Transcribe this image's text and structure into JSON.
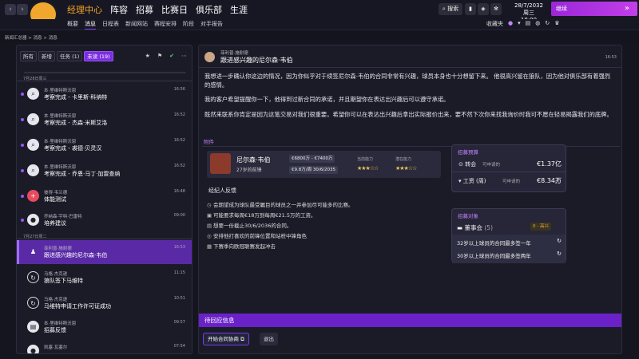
{
  "nav": {
    "main": [
      "经理中心",
      "阵容",
      "招募",
      "比赛日",
      "俱乐部",
      "生涯"
    ],
    "sub": [
      "概要",
      "消息",
      "日程表",
      "新闻网站",
      "赛程安排",
      "阶段",
      "对手报告"
    ],
    "search": "搜索",
    "date_line1": "28/7/2032",
    "date_line2": "周三 18:00",
    "continue": "继续",
    "folder": "收藏夹"
  },
  "breadcrumb": "新闻汇总器 > 消息 > 消息",
  "filters": [
    "所有",
    "新增",
    "任务 (1)",
    "未读 (19)"
  ],
  "days": [
    "7月28日周三",
    "7月27日周二"
  ],
  "messages": [
    {
      "from": "本·里维特斯沃恩",
      "subject": "考察完成 - 卡里斯·科纳特",
      "time": "16:56",
      "icon": "magnifier-icon"
    },
    {
      "from": "本·里维特斯沃恩",
      "subject": "考察完成 - 杰森·米斯艾洛",
      "time": "16:52",
      "icon": "magnifier-icon"
    },
    {
      "from": "本·里维特斯沃恩",
      "subject": "考察完成 - 裘德·贝灵汉",
      "time": "16:52",
      "icon": "magnifier-icon"
    },
    {
      "from": "本·里维特斯沃恩",
      "subject": "考察完成 - 乔恩·马丁·加雷查纳",
      "time": "16:52",
      "icon": "magnifier-icon"
    },
    {
      "from": "彼得·韦兰德",
      "subject": "体能测试",
      "time": "16:48",
      "icon": "medical-icon"
    },
    {
      "from": "乔纳森·宇特·巴雷特",
      "subject": "培养建议",
      "time": "09:00",
      "icon": "person-icon"
    },
    {
      "from": "菲利普·施耐德",
      "subject": "跟进感兴趣的尼尔森·韦伯",
      "time": "16:53",
      "icon": "person-icon"
    },
    {
      "from": "马格·杰克逊",
      "subject": "狼队签下马维特",
      "time": "11:15",
      "icon": "refresh-icon"
    },
    {
      "from": "马格·杰克逊",
      "subject": "马维特申请工作许可证成功",
      "time": "10:51",
      "icon": "refresh-icon"
    },
    {
      "from": "本·里维特斯沃恩",
      "subject": "招募反馈",
      "time": "09:57",
      "icon": "inbox-icon"
    },
    {
      "from": "凯塞·瓦塞尔",
      "subject": "",
      "time": "07:54",
      "icon": "person-icon"
    }
  ],
  "detail": {
    "from": "菲利普·施耐德",
    "subject": "跟进感兴趣的尼尔森·韦伯",
    "time": "16:53",
    "p1": "我想进一步确认你这边的情况，因为你似乎对于续签尼尔森·韦伯的合同非常有兴趣，球员本身也十分想留下来。 他很高兴留在狼队，因为他对俱乐部有着强烈的感情。",
    "p2": "我的客户希望提醒你一下，他得到过新合同的承诺，并且期望你在表达出兴趣后可以遵守承诺。",
    "p3": "既然来联系你肯定是因为这笔交易对我们很重要。希望你可以在表达出兴趣后拿出实际报价出来，要不然下次你来找我询价时我可不愿在轻易揭露我们的底牌。",
    "attach_label": "附件",
    "player_name": "尼尔森·韦伯",
    "player_info": "27岁的前锋",
    "fee_range": "€6800万 - €7400万",
    "wage_line": "€9.8万/周 30/6/2035",
    "current_ability": "当前能力",
    "potential_ability": "潜在能力",
    "agent_feedback": "经纪人反馈",
    "points": [
      "会期望成为球队最受瞩目的球员之一并参加尽可能多的比赛。",
      "可能要求每周€18万到每周€21.5万的工资。",
      "想要一份截止30/6/2036的合同。",
      "安排他打喜欢的前锋位置和站桩中锋角色",
      "下赛季向欧冠联赛发起冲击"
    ],
    "budget_title": "招募预算",
    "transfer_label": "转会",
    "transfer_sub": "可申请的",
    "transfer_val": "€1.37亿",
    "wage_label": "工资 (周)",
    "wage_sub": "可申请的",
    "wage_val": "€8.34万",
    "target_title": "招募对象",
    "board_label": "董事会",
    "board_count": "(5)",
    "board_badge": "0 - 高兴",
    "rule1": "32岁以上球员的合同最多签一年",
    "rule2": "30岁以上球员的合同最多签两年",
    "pending": "待回应信息",
    "negotiate": "开始合同协商",
    "exit": "退出"
  }
}
